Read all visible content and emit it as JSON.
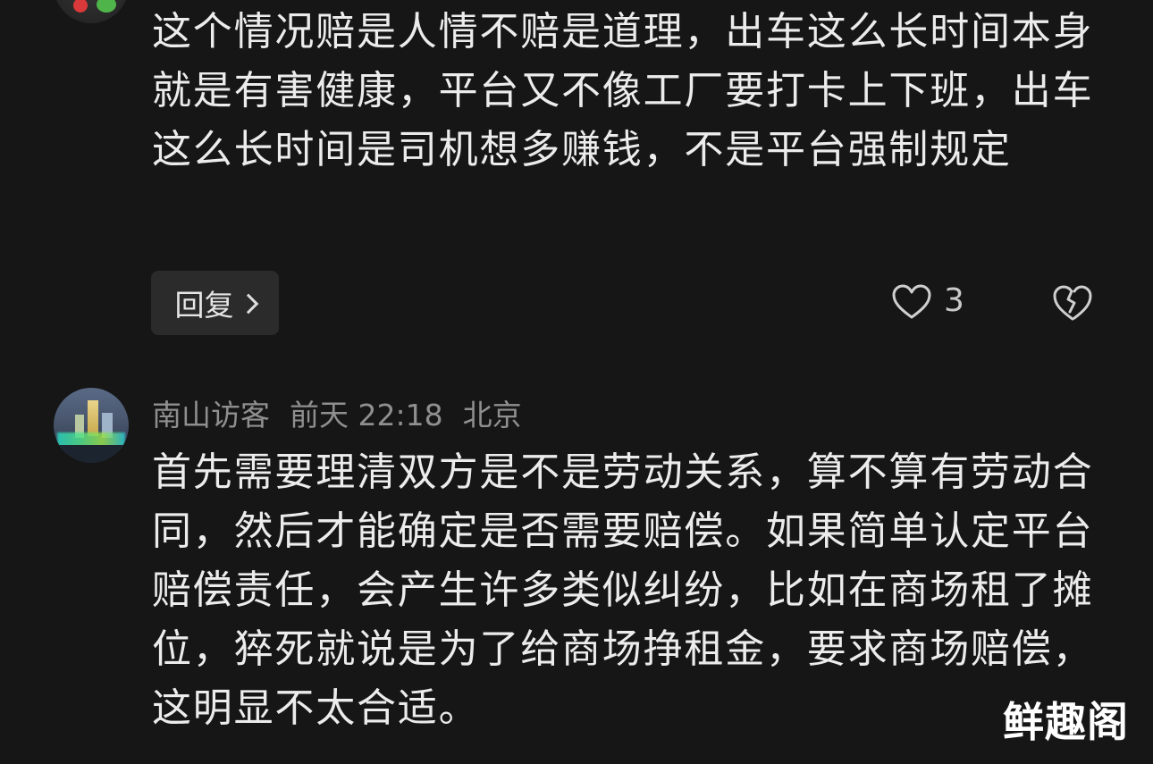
{
  "comments": [
    {
      "text": "这个情况赔是人情不赔是道理，出车这么长时间本身就是有害健康，平台又不像工厂要打卡上下班，出车这么长时间是司机想多赚钱，不是平台强制规定",
      "reply_label": "回复",
      "like_count": "3",
      "icons": {
        "like": "heart-icon",
        "dislike": "broken-heart-icon",
        "reply_arrow": "chevron-right-icon"
      }
    },
    {
      "username": "南山访客",
      "time": "前天 22:18",
      "location": "北京",
      "text": "首先需要理清双方是不是劳动关系，算不算有劳动合同，然后才能确定是否需要赔偿。如果简单认定平台赔偿责任，会产生许多类似纠纷，比如在商场租了摊位，猝死就说是为了给商场挣租金，要求商场赔偿，这明显不太合适。"
    }
  ],
  "watermark": "鲜趣阁",
  "colors": {
    "background": "#161616",
    "text": "#ececec",
    "meta": "#8f8f8f",
    "reply_button_bg": "#2b2b2b"
  }
}
